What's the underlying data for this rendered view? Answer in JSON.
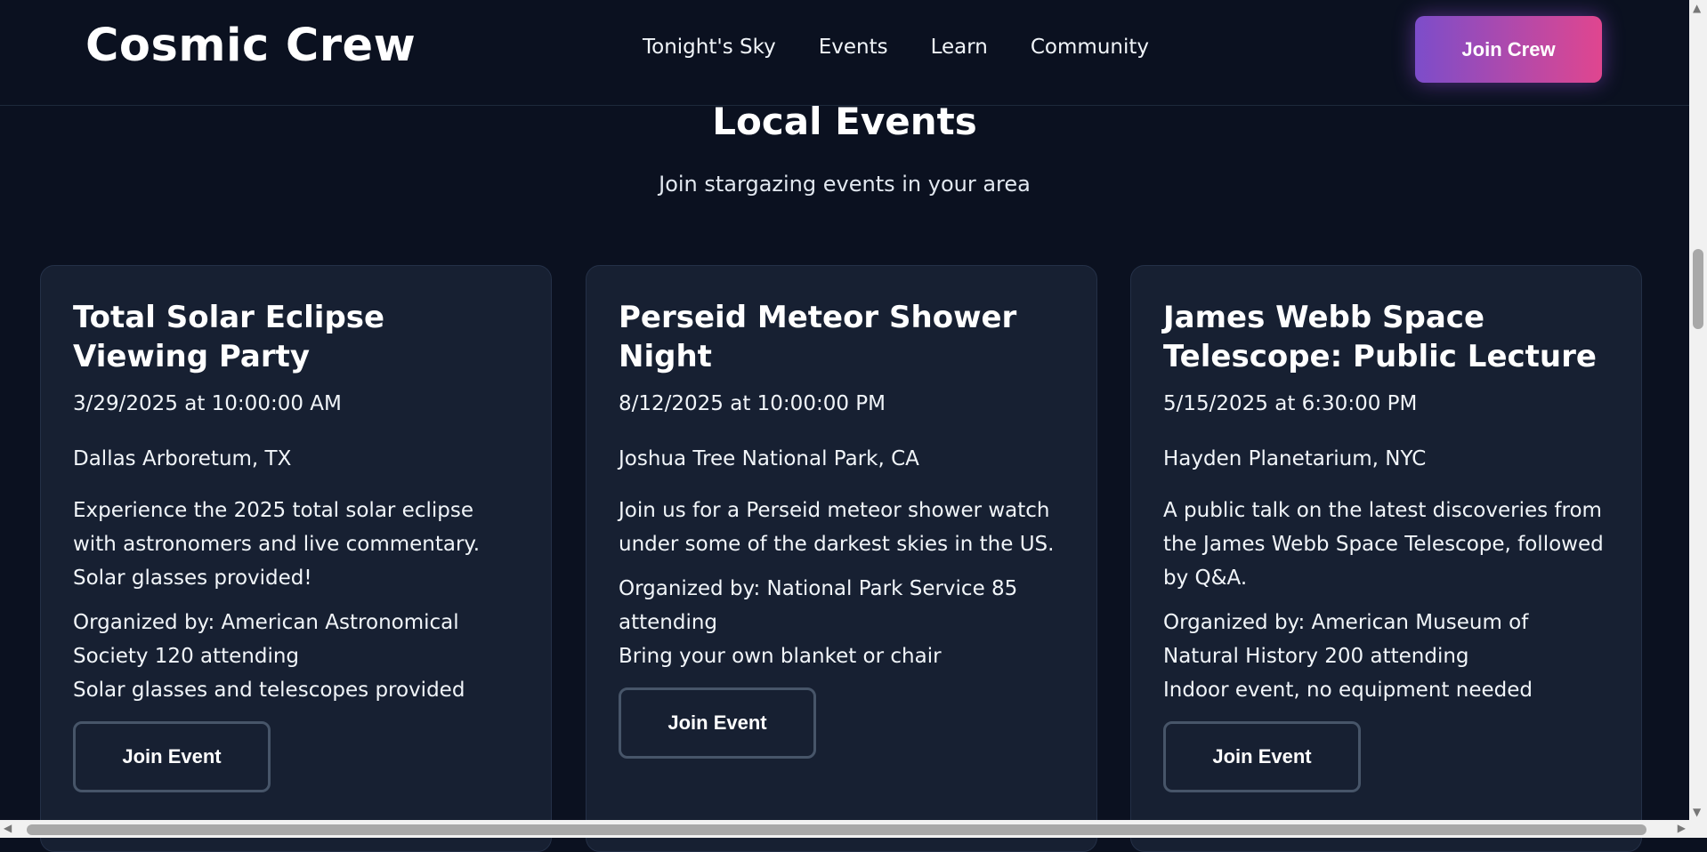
{
  "header": {
    "brand": "Cosmic Crew",
    "nav": [
      "Tonight's Sky",
      "Events",
      "Learn",
      "Community"
    ],
    "cta": "Join Crew"
  },
  "section": {
    "title": "Local Events",
    "subtitle": "Join stargazing events in your area"
  },
  "events": [
    {
      "title": "Total Solar Eclipse Viewing Party",
      "date": "3/29/2025 at 10:00:00 AM",
      "location": "Dallas Arboretum, TX",
      "description": "Experience the 2025 total solar eclipse with astronomers and live commentary. Solar glasses provided!",
      "organizer": "Organized by: American Astronomical Society 120 attending",
      "equipment": "Solar glasses and telescopes provided",
      "button": "Join Event"
    },
    {
      "title": "Perseid Meteor Shower Night",
      "date": "8/12/2025 at 10:00:00 PM",
      "location": "Joshua Tree National Park, CA",
      "description": "Join us for a Perseid meteor shower watch under some of the darkest skies in the US.",
      "organizer": "Organized by: National Park Service 85 attending",
      "equipment": "Bring your own blanket or chair",
      "button": "Join Event"
    },
    {
      "title": "James Webb Space Telescope: Public Lecture",
      "date": "5/15/2025 at 6:30:00 PM",
      "location": "Hayden Planetarium, NYC",
      "description": "A public talk on the latest discoveries from the James Webb Space Telescope, followed by Q&A.",
      "organizer": "Organized by: American Museum of Natural History 200 attending",
      "equipment": "Indoor event, no equipment needed",
      "button": "Join Event"
    }
  ]
}
